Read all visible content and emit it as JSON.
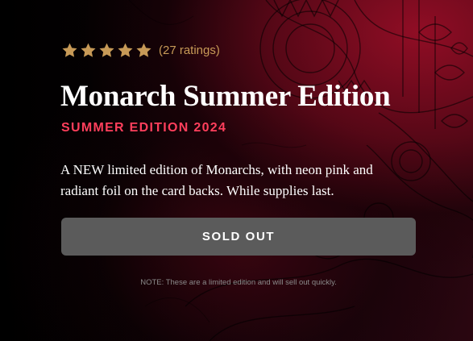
{
  "product": {
    "rating": {
      "stars_filled": 5,
      "stars_total": 5,
      "count_text": "(27 ratings)",
      "star_color": "#c79a57"
    },
    "title": "Monarch Summer Edition",
    "subtitle": "SUMMER EDITION 2024",
    "subtitle_color": "#ff3f5c",
    "description_lines": [
      "A NEW limited edition of Monarchs, with neon pink and",
      "radiant foil on the card backs. While supplies last."
    ],
    "button": {
      "label": "SOLD OUT",
      "disabled": true,
      "color": "#5b5b5b"
    },
    "note": "NOTE: These are a limited edition and will sell out quickly."
  },
  "background": {
    "accent": "#8e0c24",
    "base": "#000000"
  }
}
